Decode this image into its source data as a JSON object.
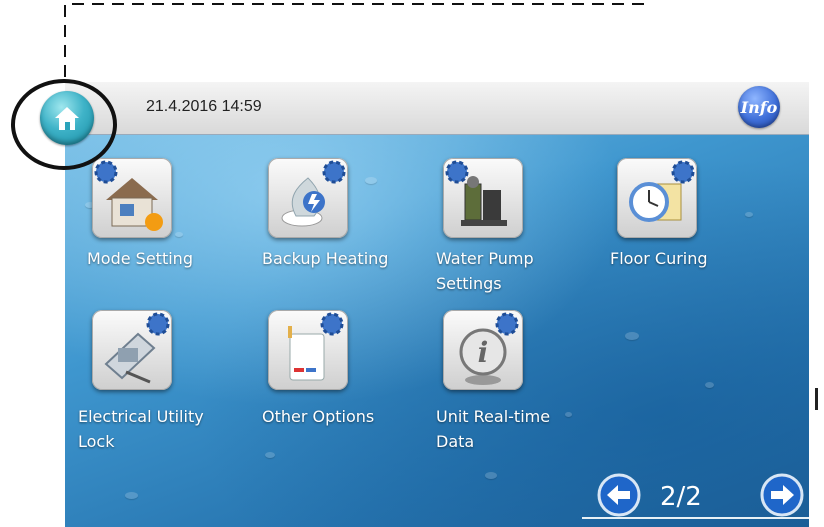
{
  "status_bar": {
    "datetime": "21.4.2016 14:59",
    "info_label": "Info"
  },
  "menu_items": [
    {
      "label": "Mode Setting",
      "icon": "house-mode-icon"
    },
    {
      "label": "Backup Heating",
      "icon": "backup-heating-icon"
    },
    {
      "label": "Water Pump\nSettings",
      "icon": "water-pump-icon"
    },
    {
      "label": "Floor Curing",
      "icon": "floor-curing-clock-icon"
    },
    {
      "label": "Electrical Utility\nLock",
      "icon": "electrical-lock-icon"
    },
    {
      "label": "Other Options",
      "icon": "other-options-icon"
    },
    {
      "label": "Unit Real-time\nData",
      "icon": "realtime-data-icon"
    }
  ],
  "pagination": {
    "indicator": "2/2",
    "current_page": 2,
    "total_pages": 2
  },
  "colors": {
    "background_blue": "#2a7bb7",
    "home_button": "#2aa3bb",
    "info_button": "#2f5fcf",
    "arrow_blue": "#1f66c9",
    "label_text": "#ffffff"
  }
}
